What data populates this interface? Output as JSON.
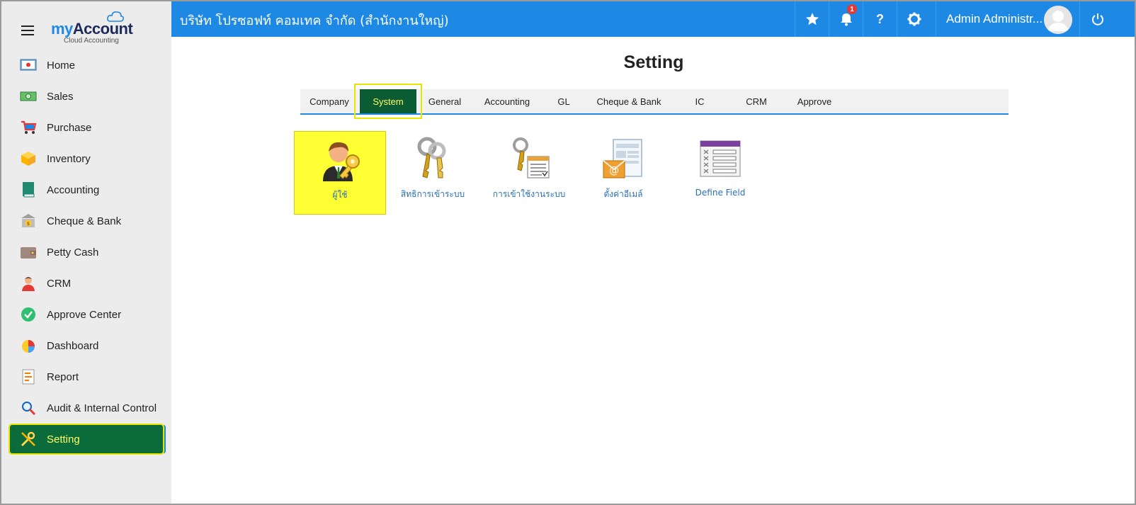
{
  "brand": {
    "logo_my": "my",
    "logo_account": "Account",
    "logo_sub": "Cloud Accounting"
  },
  "sidebar": {
    "items": [
      {
        "label": "Home",
        "icon": "home-icon"
      },
      {
        "label": "Sales",
        "icon": "money-icon"
      },
      {
        "label": "Purchase",
        "icon": "cart-icon"
      },
      {
        "label": "Inventory",
        "icon": "box-icon"
      },
      {
        "label": "Accounting",
        "icon": "book-icon"
      },
      {
        "label": "Cheque & Bank",
        "icon": "bank-icon"
      },
      {
        "label": "Petty Cash",
        "icon": "wallet-icon"
      },
      {
        "label": "CRM",
        "icon": "person-icon"
      },
      {
        "label": "Approve Center",
        "icon": "check-icon"
      },
      {
        "label": "Dashboard",
        "icon": "pie-chart-icon"
      },
      {
        "label": "Report",
        "icon": "report-icon"
      },
      {
        "label": "Audit & Internal Control",
        "icon": "magnifier-icon"
      },
      {
        "label": "Setting",
        "icon": "tools-icon",
        "active": true
      }
    ]
  },
  "topbar": {
    "company": "บริษัท โปรซอฟท์ คอมเทค จำกัด (สำนักงานใหญ่)",
    "notification_count": "1",
    "help_label": "?",
    "user_name": "Admin Administr..."
  },
  "main": {
    "title": "Setting",
    "tabs": [
      {
        "label": "Company"
      },
      {
        "label": "System",
        "active": true
      },
      {
        "label": "General"
      },
      {
        "label": "Accounting"
      },
      {
        "label": "GL"
      },
      {
        "label": "Cheque & Bank"
      },
      {
        "label": "IC"
      },
      {
        "label": "CRM"
      },
      {
        "label": "Approve"
      }
    ],
    "tiles": [
      {
        "label": "ผู้ใช้",
        "icon": "user-key-icon",
        "active": true
      },
      {
        "label": "สิทธิการเข้าระบบ",
        "icon": "keys-icon"
      },
      {
        "label": "การเข้าใช้งานระบบ",
        "icon": "keys-list-icon"
      },
      {
        "label": "ตั้งค่าอีเมล์",
        "icon": "email-settings-icon"
      },
      {
        "label": "Define Field",
        "icon": "define-field-icon"
      }
    ]
  },
  "colors": {
    "topbar": "#1e88e5",
    "active_green": "#0b5c33",
    "highlight_yellow": "#ffff33",
    "link_blue": "#2a6fb5"
  }
}
